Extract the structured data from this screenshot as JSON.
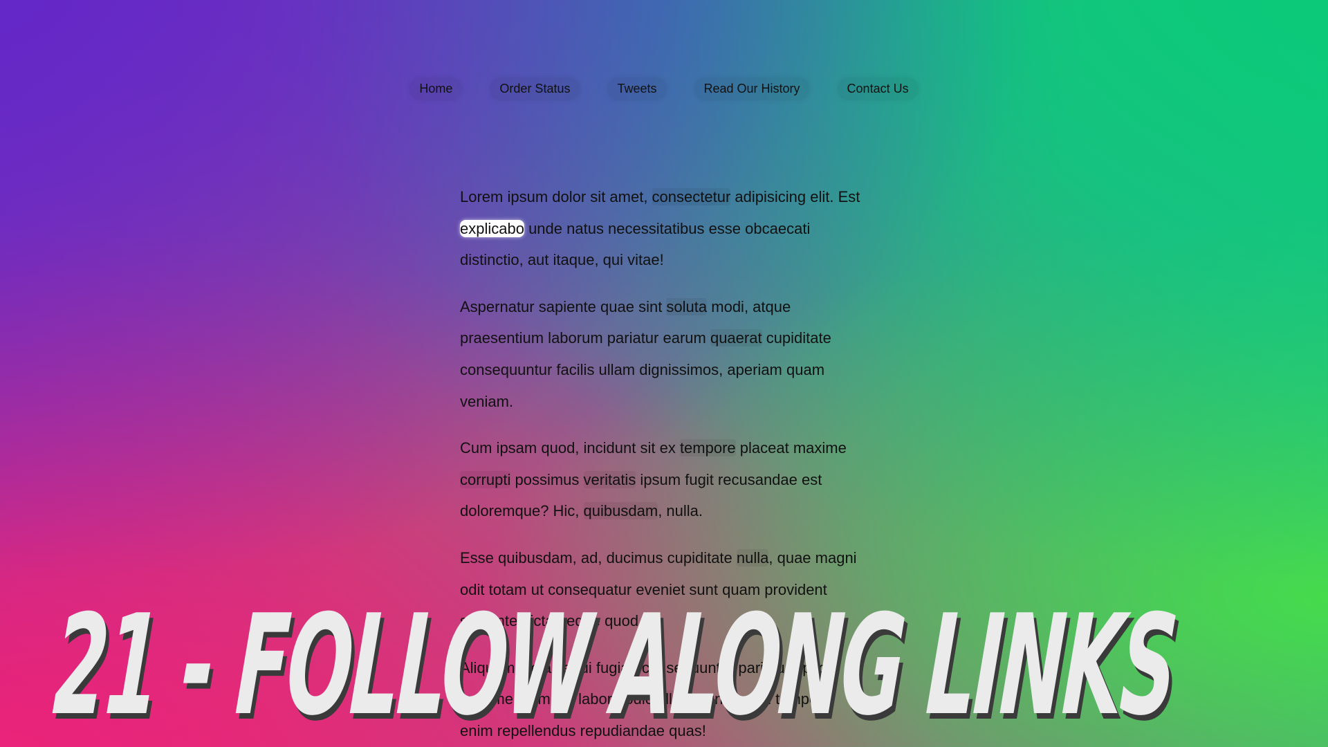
{
  "nav": {
    "items": [
      {
        "label": "Home"
      },
      {
        "label": "Order Status"
      },
      {
        "label": "Tweets"
      },
      {
        "label": "Read Our History"
      },
      {
        "label": "Contact Us"
      }
    ]
  },
  "content": {
    "p1": {
      "t1": "Lorem ipsum dolor sit amet, ",
      "l1": "consectetur",
      "t2": " adipisicing elit. Est ",
      "l2": "explicabo",
      "t3": " unde natus necessitatibus esse obcaecati distinctio, aut itaque, qui vitae!"
    },
    "p2": {
      "t1": "Aspernatur sapiente quae sint ",
      "l1": "soluta",
      "t2": " modi, atque praesentium laborum pariatur earum ",
      "l2": "quaerat",
      "t3": " cupiditate consequuntur facilis ullam dignissimos, aperiam quam veniam."
    },
    "p3": {
      "t1": "Cum ipsam quod, incidunt sit ex ",
      "l1": "tempore",
      "t2": " placeat maxime ",
      "l2": "corrupti",
      "t3": " possimus ",
      "l3": "veritatis",
      "t4": " ipsum fugit recusandae est doloremque? Hic, ",
      "l4": "quibusdam",
      "t5": ", nulla."
    },
    "p4": {
      "t1": "Esse quibusdam, ad, ducimus cupiditate ",
      "l1": "nulla",
      "t2": ", quae magni odit totam ut consequatur eveniet sunt quam provident sapiente dicta neque quod."
    },
    "p5": {
      "t1": "Aliquam dicta sequi fugiat, consequuntur pariatur optio maxime animi ex labore odio, ",
      "l1": "illo",
      "t2": " magni in sed tempore enim repellendus repudiandae quas!"
    }
  },
  "banner": {
    "title": "21 - FOLLOW ALONG LINKS"
  }
}
